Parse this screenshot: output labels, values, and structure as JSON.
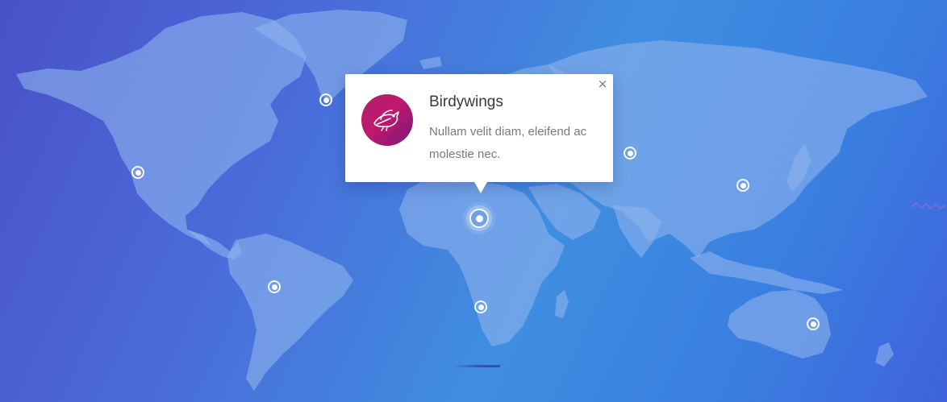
{
  "popup": {
    "title": "Birdywings",
    "description": "Nullam velit diam, eleifend ac molestie nec.",
    "close_glyph": "×",
    "logo_icon": "bird-icon",
    "logo_gradient": [
      "#b21f6a",
      "#7b1779"
    ]
  },
  "map": {
    "background_colors": [
      "#4a51c9",
      "#3f8ee0",
      "#3f63dc"
    ],
    "pins": [
      {
        "name": "pin-north-america-west"
      },
      {
        "name": "pin-greenland"
      },
      {
        "name": "pin-south-america"
      },
      {
        "name": "pin-north-africa",
        "active": true
      },
      {
        "name": "pin-southern-africa"
      },
      {
        "name": "pin-central-asia"
      },
      {
        "name": "pin-east-asia"
      },
      {
        "name": "pin-australia"
      }
    ]
  }
}
